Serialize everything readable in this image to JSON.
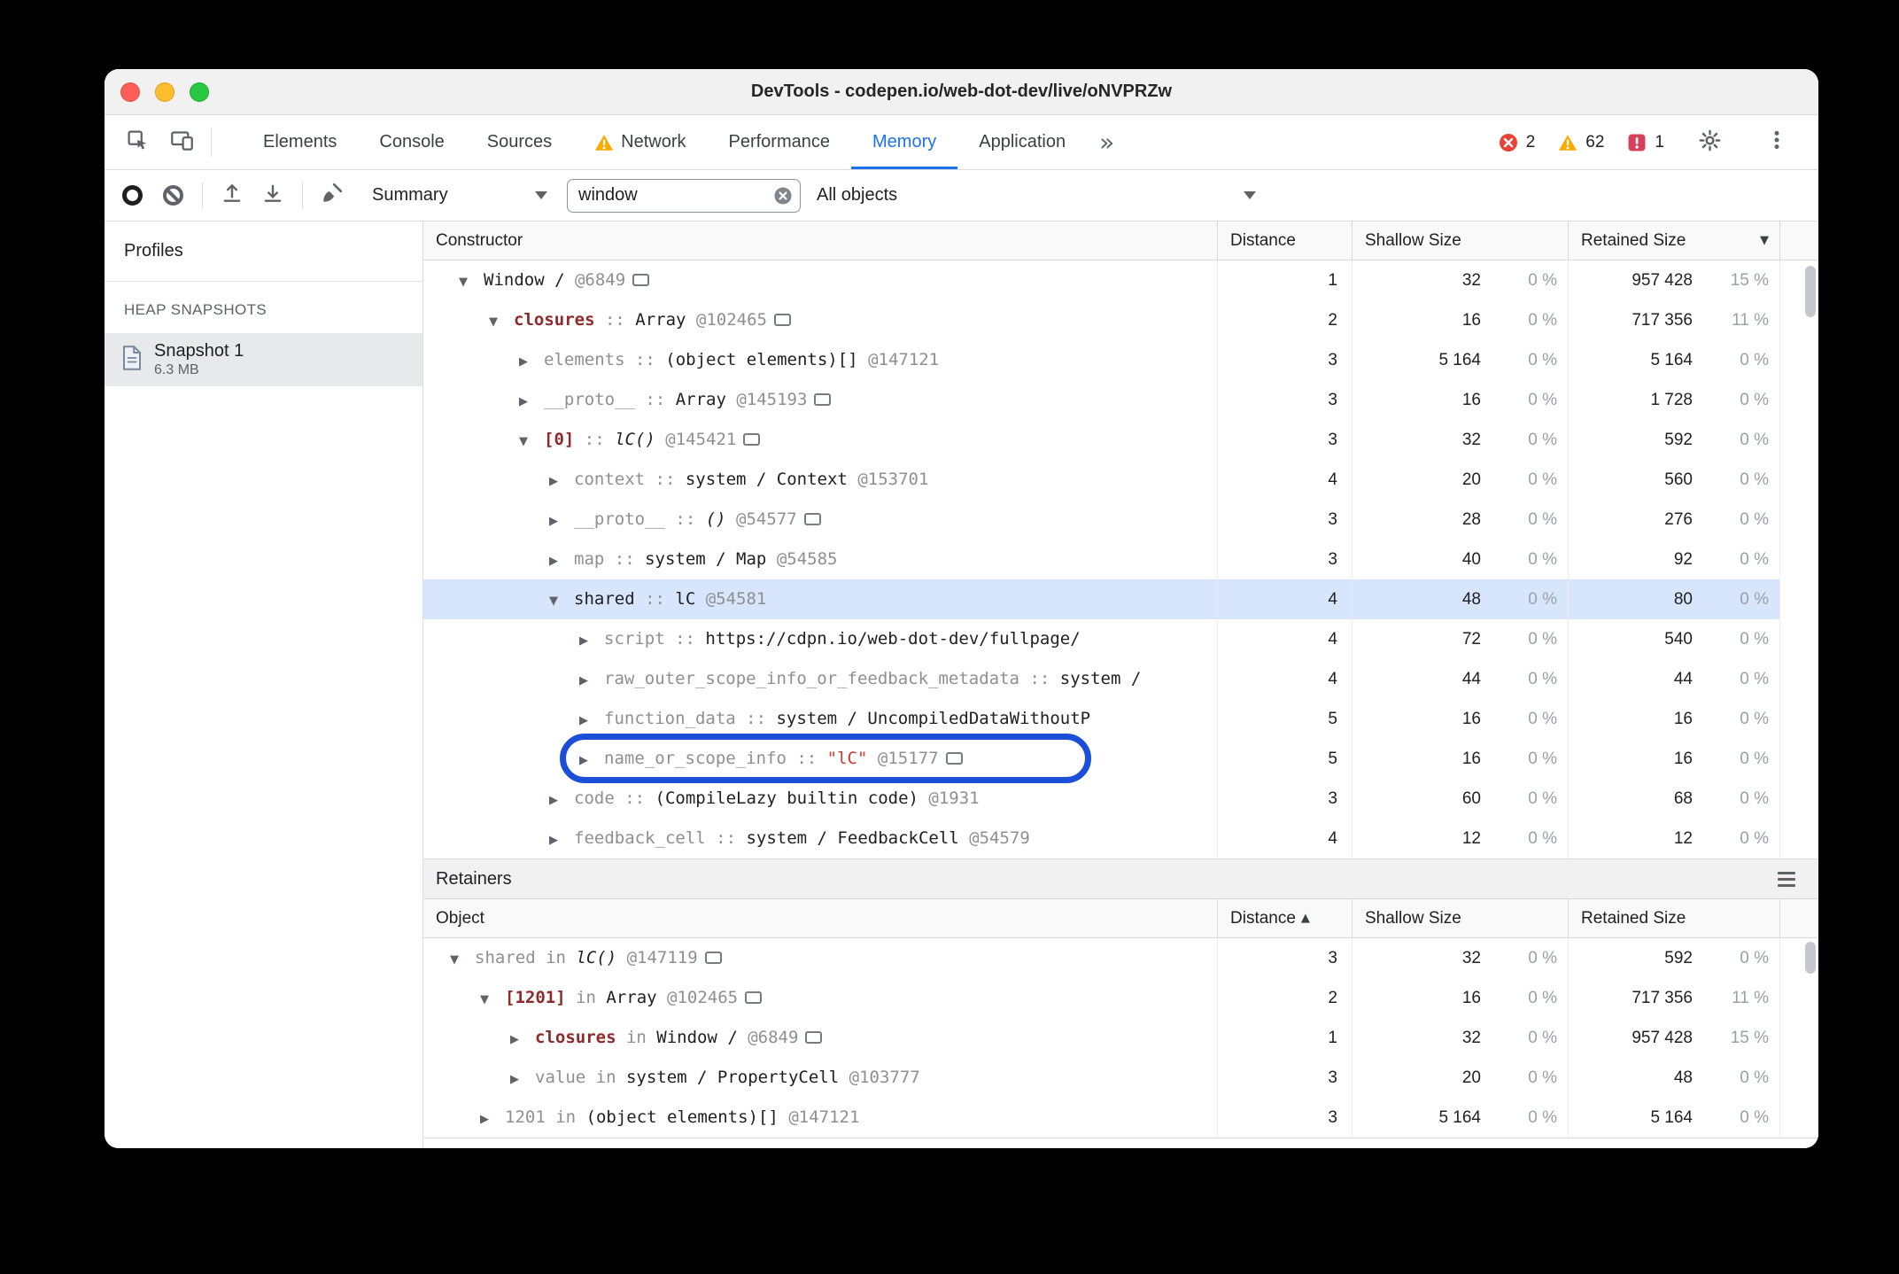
{
  "window_title": "DevTools - codepen.io/web-dot-dev/live/oNVPRZw",
  "colors": {
    "accent_blue": "#1a73e8",
    "selection_blue": "#d7e6fc",
    "annotation_blue": "#1c4fd8",
    "error_red": "#ea4335",
    "warning_amber": "#f9ab00",
    "issue_red": "#d5415a",
    "edge_name_red": "#8e2a2a",
    "string_red": "#c83c32",
    "muted_gray": "#8f8f8f"
  },
  "glyphs": {
    "expanded": "▼",
    "collapsed": "▶",
    "more_tabs": "»",
    "sort_desc": "▼",
    "sort_asc": "▲"
  },
  "tabbar": {
    "tabs": [
      {
        "label": "Elements"
      },
      {
        "label": "Console"
      },
      {
        "label": "Sources"
      },
      {
        "label": "Network",
        "warning": true
      },
      {
        "label": "Performance"
      },
      {
        "label": "Memory",
        "active": true
      },
      {
        "label": "Application"
      }
    ],
    "error_count": "2",
    "warning_count": "62",
    "issue_count": "1"
  },
  "toolbar": {
    "profile_view": "Summary",
    "search_value": "window",
    "class_filter": "All objects"
  },
  "sidebar": {
    "title": "Profiles",
    "section_label": "HEAP SNAPSHOTS",
    "snapshot_name": "Snapshot 1",
    "snapshot_size": "6.3 MB"
  },
  "constructor_grid": {
    "headers": {
      "constructor": "Constructor",
      "distance": "Distance",
      "shallow": "Shallow Size",
      "retained": "Retained Size"
    },
    "rows": [
      {
        "level": 0,
        "state": "expanded",
        "segments": [
          {
            "t": "Window / ",
            "c": "obj"
          },
          {
            "t": "@6849",
            "c": "id"
          }
        ],
        "icon": true,
        "distance": "1",
        "shallow": "32",
        "shallow_pct": "0 %",
        "retained": "957 428",
        "retained_pct": "15 %"
      },
      {
        "level": 1,
        "state": "expanded",
        "segments": [
          {
            "t": "closures",
            "c": "name"
          },
          {
            "t": " :: ",
            "c": "sep"
          },
          {
            "t": "Array ",
            "c": "obj"
          },
          {
            "t": "@102465",
            "c": "id"
          }
        ],
        "icon": true,
        "distance": "2",
        "shallow": "16",
        "shallow_pct": "0 %",
        "retained": "717 356",
        "retained_pct": "11 %"
      },
      {
        "level": 2,
        "state": "collapsed",
        "segments": [
          {
            "t": "elements",
            "c": "sys"
          },
          {
            "t": " :: ",
            "c": "sep"
          },
          {
            "t": "(object elements)[] ",
            "c": "obj"
          },
          {
            "t": "@147121",
            "c": "id"
          }
        ],
        "icon": false,
        "distance": "3",
        "shallow": "5 164",
        "shallow_pct": "0 %",
        "retained": "5 164",
        "retained_pct": "0 %"
      },
      {
        "level": 2,
        "state": "collapsed",
        "segments": [
          {
            "t": "__proto__",
            "c": "sys"
          },
          {
            "t": " :: ",
            "c": "sep"
          },
          {
            "t": "Array ",
            "c": "obj"
          },
          {
            "t": "@145193",
            "c": "id"
          }
        ],
        "icon": true,
        "distance": "3",
        "shallow": "16",
        "shallow_pct": "0 %",
        "retained": "1 728",
        "retained_pct": "0 %"
      },
      {
        "level": 2,
        "state": "expanded",
        "segments": [
          {
            "t": "[0]",
            "c": "name"
          },
          {
            "t": " :: ",
            "c": "sep"
          },
          {
            "t": "lC() ",
            "c": "fn"
          },
          {
            "t": "@145421",
            "c": "id"
          }
        ],
        "icon": true,
        "distance": "3",
        "shallow": "32",
        "shallow_pct": "0 %",
        "retained": "592",
        "retained_pct": "0 %"
      },
      {
        "level": 3,
        "state": "collapsed",
        "segments": [
          {
            "t": "context",
            "c": "sys"
          },
          {
            "t": " :: ",
            "c": "sep"
          },
          {
            "t": "system / Context ",
            "c": "obj"
          },
          {
            "t": "@153701",
            "c": "id"
          }
        ],
        "icon": false,
        "distance": "4",
        "shallow": "20",
        "shallow_pct": "0 %",
        "retained": "560",
        "retained_pct": "0 %"
      },
      {
        "level": 3,
        "state": "collapsed",
        "segments": [
          {
            "t": "__proto__",
            "c": "sys"
          },
          {
            "t": " :: ",
            "c": "sep"
          },
          {
            "t": "() ",
            "c": "fn"
          },
          {
            "t": "@54577",
            "c": "id"
          }
        ],
        "icon": true,
        "distance": "3",
        "shallow": "28",
        "shallow_pct": "0 %",
        "retained": "276",
        "retained_pct": "0 %"
      },
      {
        "level": 3,
        "state": "collapsed",
        "segments": [
          {
            "t": "map",
            "c": "sys"
          },
          {
            "t": " :: ",
            "c": "sep"
          },
          {
            "t": "system / Map ",
            "c": "obj"
          },
          {
            "t": "@54585",
            "c": "id"
          }
        ],
        "icon": false,
        "distance": "3",
        "shallow": "40",
        "shallow_pct": "0 %",
        "retained": "92",
        "retained_pct": "0 %"
      },
      {
        "level": 3,
        "state": "expanded",
        "selected": true,
        "segments": [
          {
            "t": "shared",
            "c": "obj"
          },
          {
            "t": " :: ",
            "c": "sep"
          },
          {
            "t": "lC ",
            "c": "obj"
          },
          {
            "t": "@54581",
            "c": "id"
          }
        ],
        "icon": false,
        "distance": "4",
        "shallow": "48",
        "shallow_pct": "0 %",
        "retained": "80",
        "retained_pct": "0 %"
      },
      {
        "level": 4,
        "state": "collapsed",
        "segments": [
          {
            "t": "script",
            "c": "sys"
          },
          {
            "t": " :: ",
            "c": "sep"
          },
          {
            "t": "https://cdpn.io/web-dot-dev/fullpage/",
            "c": "obj"
          }
        ],
        "icon": false,
        "distance": "4",
        "shallow": "72",
        "shallow_pct": "0 %",
        "retained": "540",
        "retained_pct": "0 %"
      },
      {
        "level": 4,
        "state": "collapsed",
        "segments": [
          {
            "t": "raw_outer_scope_info_or_feedback_metadata",
            "c": "sys"
          },
          {
            "t": " :: ",
            "c": "sep"
          },
          {
            "t": "system /",
            "c": "obj"
          }
        ],
        "icon": false,
        "distance": "4",
        "shallow": "44",
        "shallow_pct": "0 %",
        "retained": "44",
        "retained_pct": "0 %"
      },
      {
        "level": 4,
        "state": "collapsed",
        "segments": [
          {
            "t": "function_data",
            "c": "sys"
          },
          {
            "t": " :: ",
            "c": "sep"
          },
          {
            "t": "system / UncompiledDataWithoutP",
            "c": "obj"
          }
        ],
        "icon": false,
        "distance": "5",
        "shallow": "16",
        "shallow_pct": "0 %",
        "retained": "16",
        "retained_pct": "0 %"
      },
      {
        "level": 4,
        "state": "collapsed",
        "annotated": true,
        "segments": [
          {
            "t": "name_or_scope_info",
            "c": "sys"
          },
          {
            "t": " :: ",
            "c": "sep"
          },
          {
            "t": "\"lC\" ",
            "c": "str"
          },
          {
            "t": "@15177",
            "c": "id"
          }
        ],
        "icon": true,
        "distance": "5",
        "shallow": "16",
        "shallow_pct": "0 %",
        "retained": "16",
        "retained_pct": "0 %"
      },
      {
        "level": 3,
        "state": "collapsed",
        "segments": [
          {
            "t": "code",
            "c": "sys"
          },
          {
            "t": " :: ",
            "c": "sep"
          },
          {
            "t": "(CompileLazy builtin code) ",
            "c": "obj"
          },
          {
            "t": "@1931",
            "c": "id"
          }
        ],
        "icon": false,
        "distance": "3",
        "shallow": "60",
        "shallow_pct": "0 %",
        "retained": "68",
        "retained_pct": "0 %"
      },
      {
        "level": 3,
        "state": "collapsed",
        "segments": [
          {
            "t": "feedback_cell",
            "c": "sys"
          },
          {
            "t": " :: ",
            "c": "sep"
          },
          {
            "t": "system / FeedbackCell ",
            "c": "obj"
          },
          {
            "t": "@54579",
            "c": "id"
          }
        ],
        "icon": false,
        "distance": "4",
        "shallow": "12",
        "shallow_pct": "0 %",
        "retained": "12",
        "retained_pct": "0 %"
      }
    ]
  },
  "retainers": {
    "title": "Retainers",
    "headers": {
      "object": "Object",
      "distance": "Distance",
      "shallow": "Shallow Size",
      "retained": "Retained Size"
    },
    "rows": [
      {
        "level": 0,
        "state": "expanded",
        "segments": [
          {
            "t": "shared",
            "c": "sys"
          },
          {
            "t": " in ",
            "c": "sep"
          },
          {
            "t": "lC() ",
            "c": "fn"
          },
          {
            "t": "@147119",
            "c": "id"
          }
        ],
        "icon": true,
        "distance": "3",
        "shallow": "32",
        "shallow_pct": "0 %",
        "retained": "592",
        "retained_pct": "0 %"
      },
      {
        "level": 1,
        "state": "expanded",
        "segments": [
          {
            "t": "[1201]",
            "c": "name"
          },
          {
            "t": " in ",
            "c": "sep"
          },
          {
            "t": "Array ",
            "c": "obj"
          },
          {
            "t": "@102465",
            "c": "id"
          }
        ],
        "icon": true,
        "distance": "2",
        "shallow": "16",
        "shallow_pct": "0 %",
        "retained": "717 356",
        "retained_pct": "11 %"
      },
      {
        "level": 2,
        "state": "collapsed",
        "segments": [
          {
            "t": "closures",
            "c": "name"
          },
          {
            "t": " in ",
            "c": "sep"
          },
          {
            "t": "Window / ",
            "c": "obj"
          },
          {
            "t": "@6849",
            "c": "id"
          }
        ],
        "icon": true,
        "distance": "1",
        "shallow": "32",
        "shallow_pct": "0 %",
        "retained": "957 428",
        "retained_pct": "15 %"
      },
      {
        "level": 2,
        "state": "collapsed",
        "segments": [
          {
            "t": "value",
            "c": "sys"
          },
          {
            "t": " in ",
            "c": "sep"
          },
          {
            "t": "system / PropertyCell ",
            "c": "obj"
          },
          {
            "t": "@103777",
            "c": "id"
          }
        ],
        "icon": false,
        "distance": "3",
        "shallow": "20",
        "shallow_pct": "0 %",
        "retained": "48",
        "retained_pct": "0 %"
      },
      {
        "level": 1,
        "state": "collapsed",
        "segments": [
          {
            "t": "1201",
            "c": "sys"
          },
          {
            "t": " in ",
            "c": "sep"
          },
          {
            "t": "(object elements)[] ",
            "c": "obj"
          },
          {
            "t": "@147121",
            "c": "id"
          }
        ],
        "icon": false,
        "distance": "3",
        "shallow": "5 164",
        "shallow_pct": "0 %",
        "retained": "5 164",
        "retained_pct": "0 %"
      }
    ]
  }
}
